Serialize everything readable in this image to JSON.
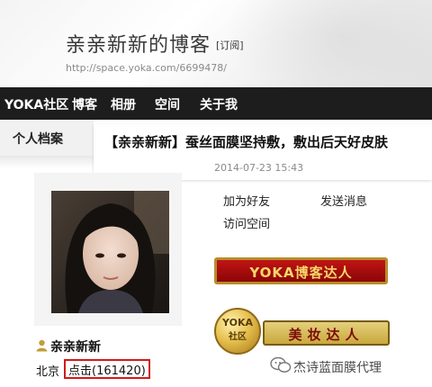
{
  "blog": {
    "title": "亲亲新新的博客",
    "subscribe_label": "[订阅]",
    "url": "http://space.yoka.com/6699478/"
  },
  "nav": {
    "items": [
      "YOKA社区",
      "博客",
      "相册",
      "空间",
      "关于我"
    ]
  },
  "sidebar": {
    "tab_label": "个人档案"
  },
  "article": {
    "title": "【亲亲新新】蚕丝面膜坚持敷，敷出后天好皮肤",
    "date": "2014-07-23 15:43"
  },
  "profile": {
    "actions": {
      "add_friend": "加为好友",
      "send_message": "发送消息",
      "visit_space": "访问空间"
    },
    "badges": {
      "blogger": "YOKA博客达人",
      "medal_line1": "YOKA",
      "medal_line2": "社区",
      "beauty": "美妆达人"
    },
    "username": "亲亲新新",
    "location": "北京",
    "hits_label": "点击",
    "hits_count": "(161420)"
  },
  "watermark": {
    "text": "杰诗蓝面膜代理"
  },
  "colors": {
    "nav_bg": "#1d1d1d",
    "badge_red": "#c11414",
    "badge_gold": "#f6d76a",
    "highlight_border": "#d21a1a"
  }
}
